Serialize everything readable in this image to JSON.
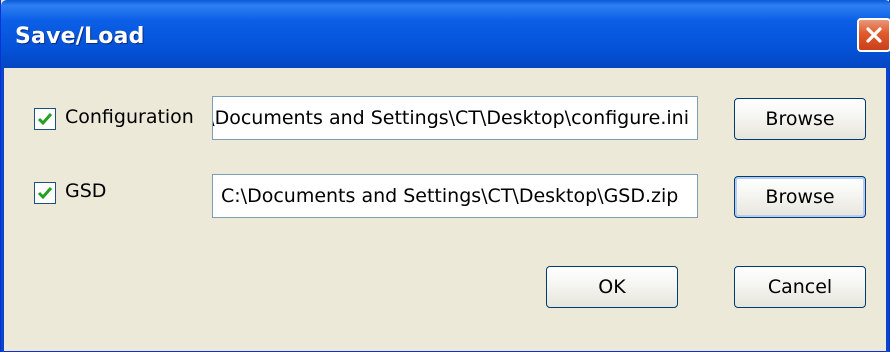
{
  "window": {
    "title": "Save/Load",
    "close_glyph": "✕"
  },
  "rows": [
    {
      "label": "Configuration",
      "checked": true,
      "path": "C:\\Documents and Settings\\CT\\Desktop\\configure.ini",
      "browse_label": "Browse"
    },
    {
      "label": "GSD",
      "checked": true,
      "path": "C:\\Documents and Settings\\CT\\Desktop\\GSD.zip",
      "browse_label": "Browse"
    }
  ],
  "footer": {
    "ok_label": "OK",
    "cancel_label": "Cancel"
  },
  "colors": {
    "titlebar": "#0453d8",
    "dialog_bg": "#ece9d8",
    "check_green": "#21a121",
    "close_red": "#e05a2c"
  }
}
